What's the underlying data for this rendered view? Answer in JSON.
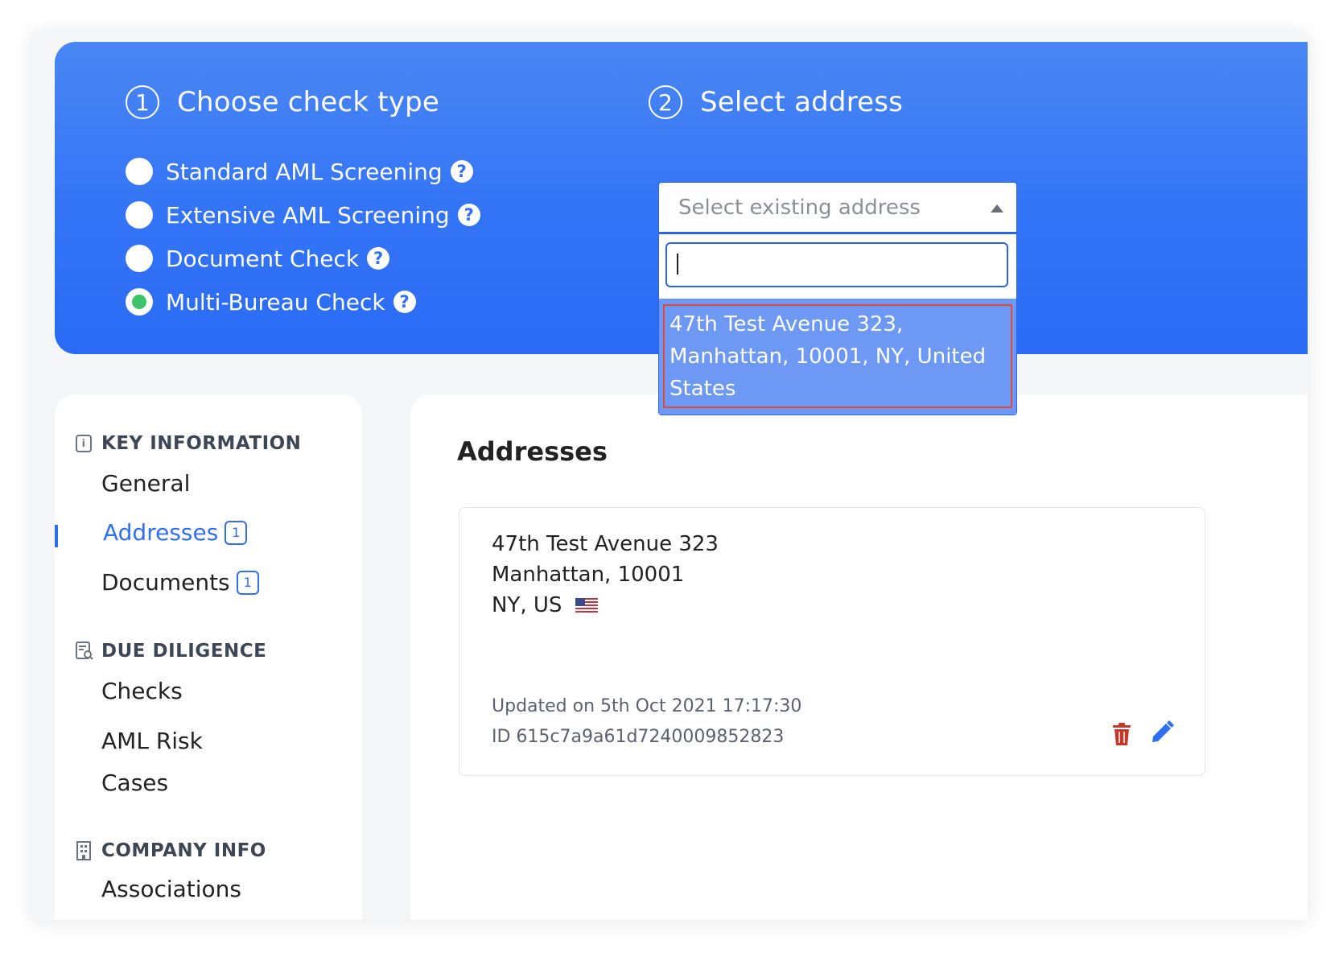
{
  "steps": {
    "step1": {
      "number": "1",
      "title": "Choose check type"
    },
    "step2": {
      "number": "2",
      "title": "Select address"
    }
  },
  "check_types": [
    {
      "label": "Standard AML Screening",
      "selected": false
    },
    {
      "label": "Extensive AML Screening",
      "selected": false
    },
    {
      "label": "Document Check",
      "selected": false
    },
    {
      "label": "Multi-Bureau Check",
      "selected": true
    }
  ],
  "help_glyph": "?",
  "address_select": {
    "placeholder": "Select existing address",
    "search_value": "",
    "options": [
      "47th Test Avenue 323, Manhattan, 10001, NY, United States"
    ]
  },
  "sidebar": {
    "key_information": {
      "heading": "KEY INFORMATION",
      "icon_glyph": "i",
      "items": [
        {
          "label": "General"
        },
        {
          "label": "Addresses",
          "badge": "1",
          "active": true
        },
        {
          "label": "Documents",
          "badge": "1"
        }
      ]
    },
    "due_diligence": {
      "heading": "DUE DILIGENCE",
      "items": [
        {
          "label": "Checks"
        },
        {
          "label": "AML Risk"
        },
        {
          "label": "Cases"
        }
      ]
    },
    "company_info": {
      "heading": "COMPANY INFO",
      "items": [
        {
          "label": "Associations"
        }
      ]
    }
  },
  "main": {
    "title": "Addresses",
    "address_card": {
      "line1": "47th Test Avenue 323",
      "line2": "Manhattan, 10001",
      "line3": "NY, US",
      "updated": "Updated on 5th Oct 2021 17:17:30",
      "id": "ID 615c7a9a61d7240009852823"
    }
  },
  "colors": {
    "brand_blue": "#2f6ff5",
    "selected_radio": "#3cc46a",
    "delete_red": "#c0392b",
    "highlight_outline": "#e04b3e"
  }
}
